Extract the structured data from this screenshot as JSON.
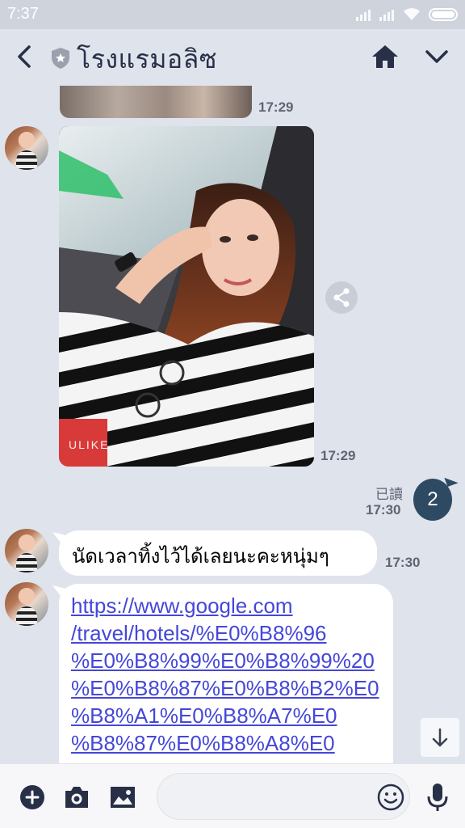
{
  "status_bar": {
    "time": "7:37"
  },
  "header": {
    "title": "โรงแรมอลิซ",
    "icons": [
      "back-arrow-icon",
      "shield-icon",
      "home-icon",
      "chevron-down-icon"
    ]
  },
  "messages": [
    {
      "type": "image",
      "sender": "other",
      "time": "17:29",
      "partial": true
    },
    {
      "type": "image",
      "sender": "other",
      "time": "17:29",
      "watermark": "ULIKE"
    },
    {
      "type": "sticker",
      "sender": "me",
      "content": "2",
      "read_label": "已讀",
      "time": "17:30"
    },
    {
      "type": "text",
      "sender": "other",
      "text": "นัดเวลาทิ้งไว้ได้เลยนะคะหนุ่มๆ",
      "time": "17:30"
    },
    {
      "type": "link",
      "sender": "other",
      "lines": [
        "https://www.google.com",
        "/travel/hotels/%E0%B8%96",
        "%E0%B8%99%E0%B8%99%20",
        "%E0%B8%87%E0%B8%B2%E0",
        "%B8%A1%E0%B8%A7%E0",
        "%B8%87%E0%B8%A8%E0"
      ]
    }
  ],
  "input_bar": {
    "icons": [
      "add-icon",
      "camera-icon",
      "image-icon",
      "emoji-icon",
      "microphone-icon"
    ]
  },
  "colors": {
    "chat_background": "#dfe3ec",
    "header_text": "#283048",
    "link": "#4547d8",
    "sticker_bubble": "#2e4a63"
  }
}
